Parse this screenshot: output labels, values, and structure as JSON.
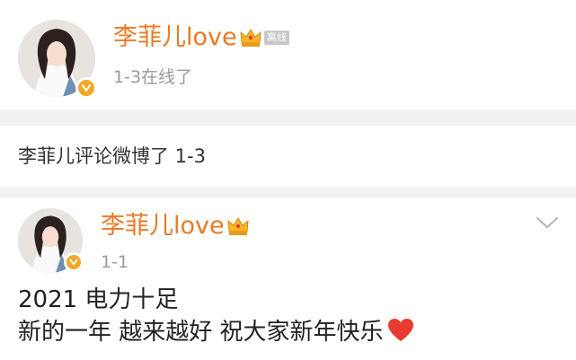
{
  "status_card": {
    "user_name": "李菲儿love",
    "offline_tag": "离线",
    "status_time": "1-3在线了"
  },
  "activity_notice": "李菲儿评论微博了 1-3",
  "post": {
    "user_name": "李菲儿love",
    "time": "1-1",
    "lines": [
      "2021 电力十足",
      "新的一年 越来越好 祝大家新年快乐"
    ]
  },
  "colors": {
    "name_orange": "#ea7a26",
    "verified_gold": "#f5a623",
    "heart_red": "#e63b2e",
    "separator": "#f1f1f1"
  },
  "icons": [
    "crown-icon",
    "verified-badge-icon",
    "chevron-down-icon",
    "heart-emoji-icon"
  ]
}
